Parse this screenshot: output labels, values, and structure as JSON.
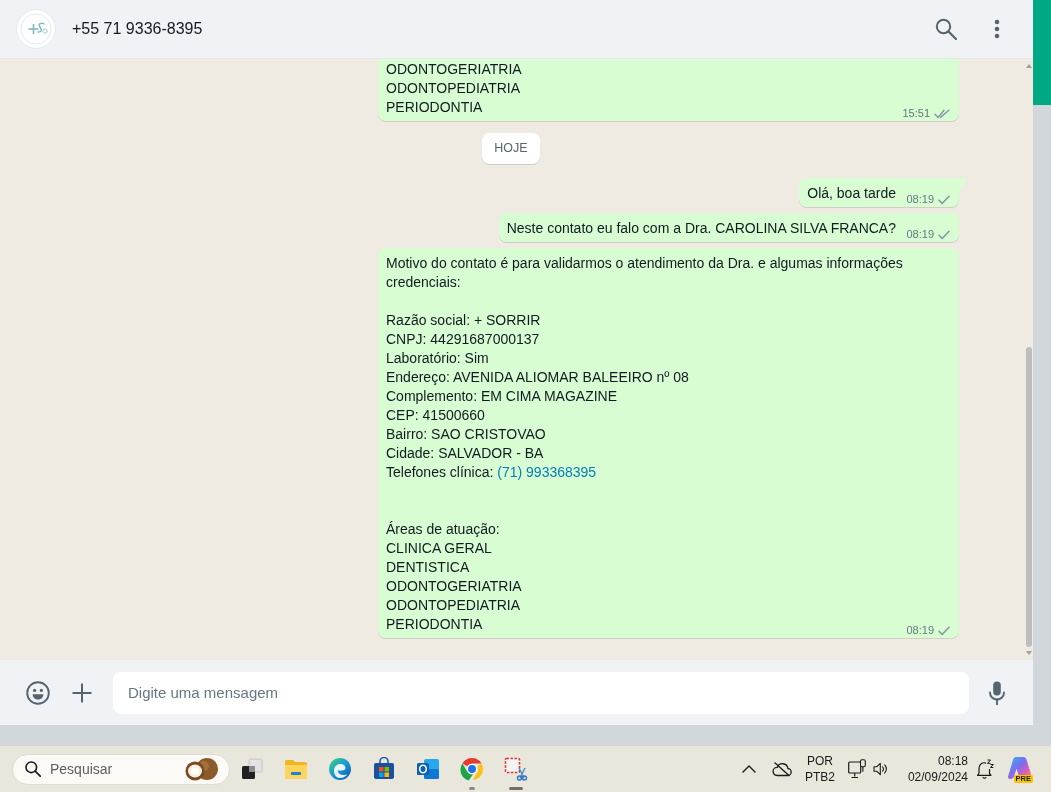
{
  "chat_header": {
    "contact": "+55 71 9336-8395"
  },
  "messages": [
    {
      "kind": "outgoing",
      "cut_off_top": true,
      "tail": false,
      "lines": [
        {
          "kind": "text",
          "text": "ODONTOGERIATRIA"
        },
        {
          "kind": "text",
          "text": "ODONTOPEDIATRIA"
        },
        {
          "kind": "text",
          "text": "PERIODONTIA"
        }
      ],
      "time": "15:51",
      "delivered": true
    },
    {
      "kind": "date",
      "label": "HOJE"
    },
    {
      "kind": "outgoing",
      "cut_off_top": false,
      "tail": true,
      "lines": [
        {
          "kind": "text",
          "text": "Olá, boa tarde"
        }
      ],
      "time": "08:19",
      "delivered": false
    },
    {
      "kind": "outgoing",
      "cut_off_top": false,
      "tail": false,
      "lines": [
        {
          "kind": "text",
          "text": "Neste contato eu falo com a Dra. CAROLINA SILVA FRANCA?"
        }
      ],
      "time": "08:19",
      "delivered": false
    },
    {
      "kind": "outgoing",
      "cut_off_top": false,
      "tail": false,
      "lines": [
        {
          "kind": "text",
          "text": "Motivo do contato é para validarmos o atendimento da Dra. e algumas informações credenciais:"
        },
        {
          "kind": "blank"
        },
        {
          "kind": "text",
          "text": "Razão social: + SORRIR"
        },
        {
          "kind": "text",
          "text": "CNPJ: 44291687000137"
        },
        {
          "kind": "text",
          "text": "Laboratório: Sim"
        },
        {
          "kind": "text",
          "text": "Endereço: AVENIDA ALIOMAR BALEEIRO nº 08"
        },
        {
          "kind": "text",
          "text": "Complemento: EM CIMA MAGAZINE"
        },
        {
          "kind": "text",
          "text": "CEP: 41500660"
        },
        {
          "kind": "text",
          "text": "Bairro: SAO CRISTOVAO"
        },
        {
          "kind": "text",
          "text": "Cidade: SALVADOR - BA"
        },
        {
          "kind": "link",
          "text": "Telefones clínica:",
          "link": "(71) 993368395"
        },
        {
          "kind": "blank"
        },
        {
          "kind": "blank"
        },
        {
          "kind": "text",
          "text": "Áreas de atuação:"
        },
        {
          "kind": "text",
          "text": "CLINICA GERAL"
        },
        {
          "kind": "text",
          "text": "DENTISTICA"
        },
        {
          "kind": "text",
          "text": "ODONTOGERIATRIA"
        },
        {
          "kind": "text",
          "text": "ODONTOPEDIATRIA"
        },
        {
          "kind": "text",
          "text": "PERIODONTIA"
        }
      ],
      "time": "08:19",
      "delivered": false
    }
  ],
  "composer": {
    "placeholder": "Digite uma mensagem"
  },
  "taskbar": {
    "search": {
      "placeholder": "Pesquisar"
    },
    "apps": [
      {
        "kind": "task_view",
        "running": false,
        "selected": false
      },
      {
        "kind": "folder",
        "running": false,
        "selected": false
      },
      {
        "kind": "swirl_browser",
        "running": false,
        "selected": false
      },
      {
        "kind": "store",
        "running": false,
        "selected": false
      },
      {
        "kind": "mail",
        "running": false,
        "selected": false
      },
      {
        "kind": "round_browser",
        "running": true,
        "selected": false
      },
      {
        "kind": "snipping",
        "running": true,
        "selected": true
      }
    ],
    "tray": {
      "input_language": "POR",
      "keyboard_layout": "PTB2",
      "time": "08:18",
      "date": "02/09/2024",
      "app_tag": "PRE"
    }
  }
}
